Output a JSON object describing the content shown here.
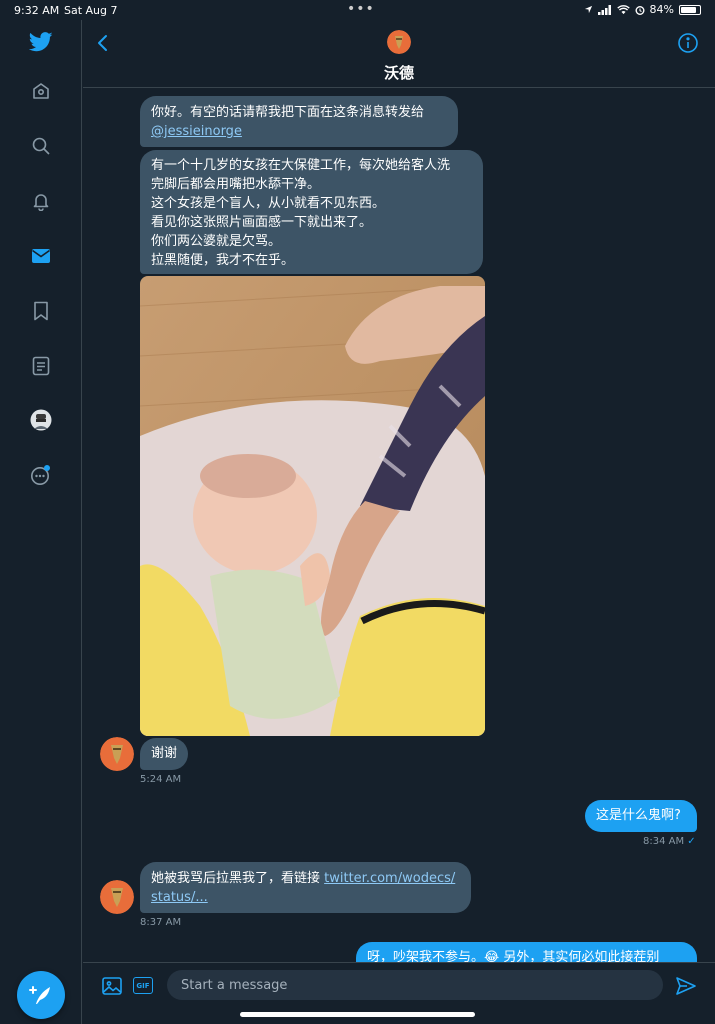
{
  "status": {
    "time": "9:32 AM",
    "date": "Sat Aug 7",
    "battery_pct": "84%",
    "battery_level": 0.84
  },
  "colors": {
    "accent": "#1da1f2",
    "background": "#15202b",
    "bubble_in": "#3d5466",
    "divider": "#38444d"
  },
  "sidebar": {
    "items": [
      {
        "name": "twitter-logo-icon"
      },
      {
        "name": "home-icon"
      },
      {
        "name": "search-icon"
      },
      {
        "name": "notifications-icon"
      },
      {
        "name": "messages-icon"
      },
      {
        "name": "bookmark-icon"
      },
      {
        "name": "lists-icon"
      },
      {
        "name": "profile-avatar"
      },
      {
        "name": "more-icon"
      }
    ],
    "compose_icon": "compose-tweet-icon"
  },
  "header": {
    "name": "沃德",
    "back_icon": "chevron-left-icon",
    "info_icon": "info-icon"
  },
  "messages": [
    {
      "lines": [
        "你好。有空的话请帮我把下面在这条消息转发给"
      ],
      "link": "@jessieinorge"
    },
    {
      "lines": [
        "有一个十几岁的女孩在大保健工作，每次她给客人洗",
        "完脚后都会用嘴把水舔干净。",
        "这个女孩是个盲人，从小就看不见东西。",
        "看见你这张照片画面感一下就出来了。",
        "你们两公婆就是欠骂。",
        "拉黑随便，我才不在乎。"
      ]
    },
    {
      "text": "谢谢",
      "time": "5:24 AM"
    },
    {
      "text": "这是什么鬼啊?",
      "time": "8:34 AM",
      "check": "✓"
    },
    {
      "text": "她被我骂后拉黑我了，看链接 ",
      "link1": "twitter.com/wodecs/",
      "link2": "status/...",
      "time": "8:37 AM"
    },
    {
      "text": "呀，吵架我不参与。😂 另外，其实何必如此接茬别"
    }
  ],
  "composer": {
    "placeholder": "Start a message",
    "gif_label": "GIF"
  }
}
